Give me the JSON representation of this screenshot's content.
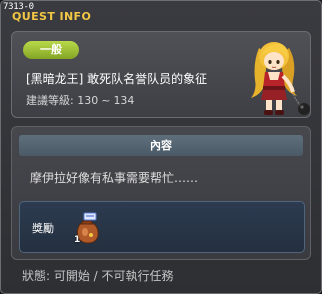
{
  "window": {
    "quest_id": "7313-0",
    "title": "QUEST INFO"
  },
  "header": {
    "category": "一般",
    "quest_title": "[黑暗龙王] 敢死队名誉队员的象征",
    "level_label": "建議等級:",
    "level_min": "130",
    "level_sep": "~",
    "level_max": "134"
  },
  "content": {
    "section_title": "內容",
    "description": "摩伊拉好像有私事需要帮忙……"
  },
  "reward": {
    "label": "獎勵",
    "item_icon": "reward-bag-icon",
    "item_count": "1"
  },
  "status": {
    "text": "狀態: 可開始 / 不可執行任務"
  },
  "colors": {
    "title_yellow": "#f2c744",
    "badge_green": "#9cc232",
    "content_header": "#556572",
    "reward_box": "#2a3647"
  }
}
